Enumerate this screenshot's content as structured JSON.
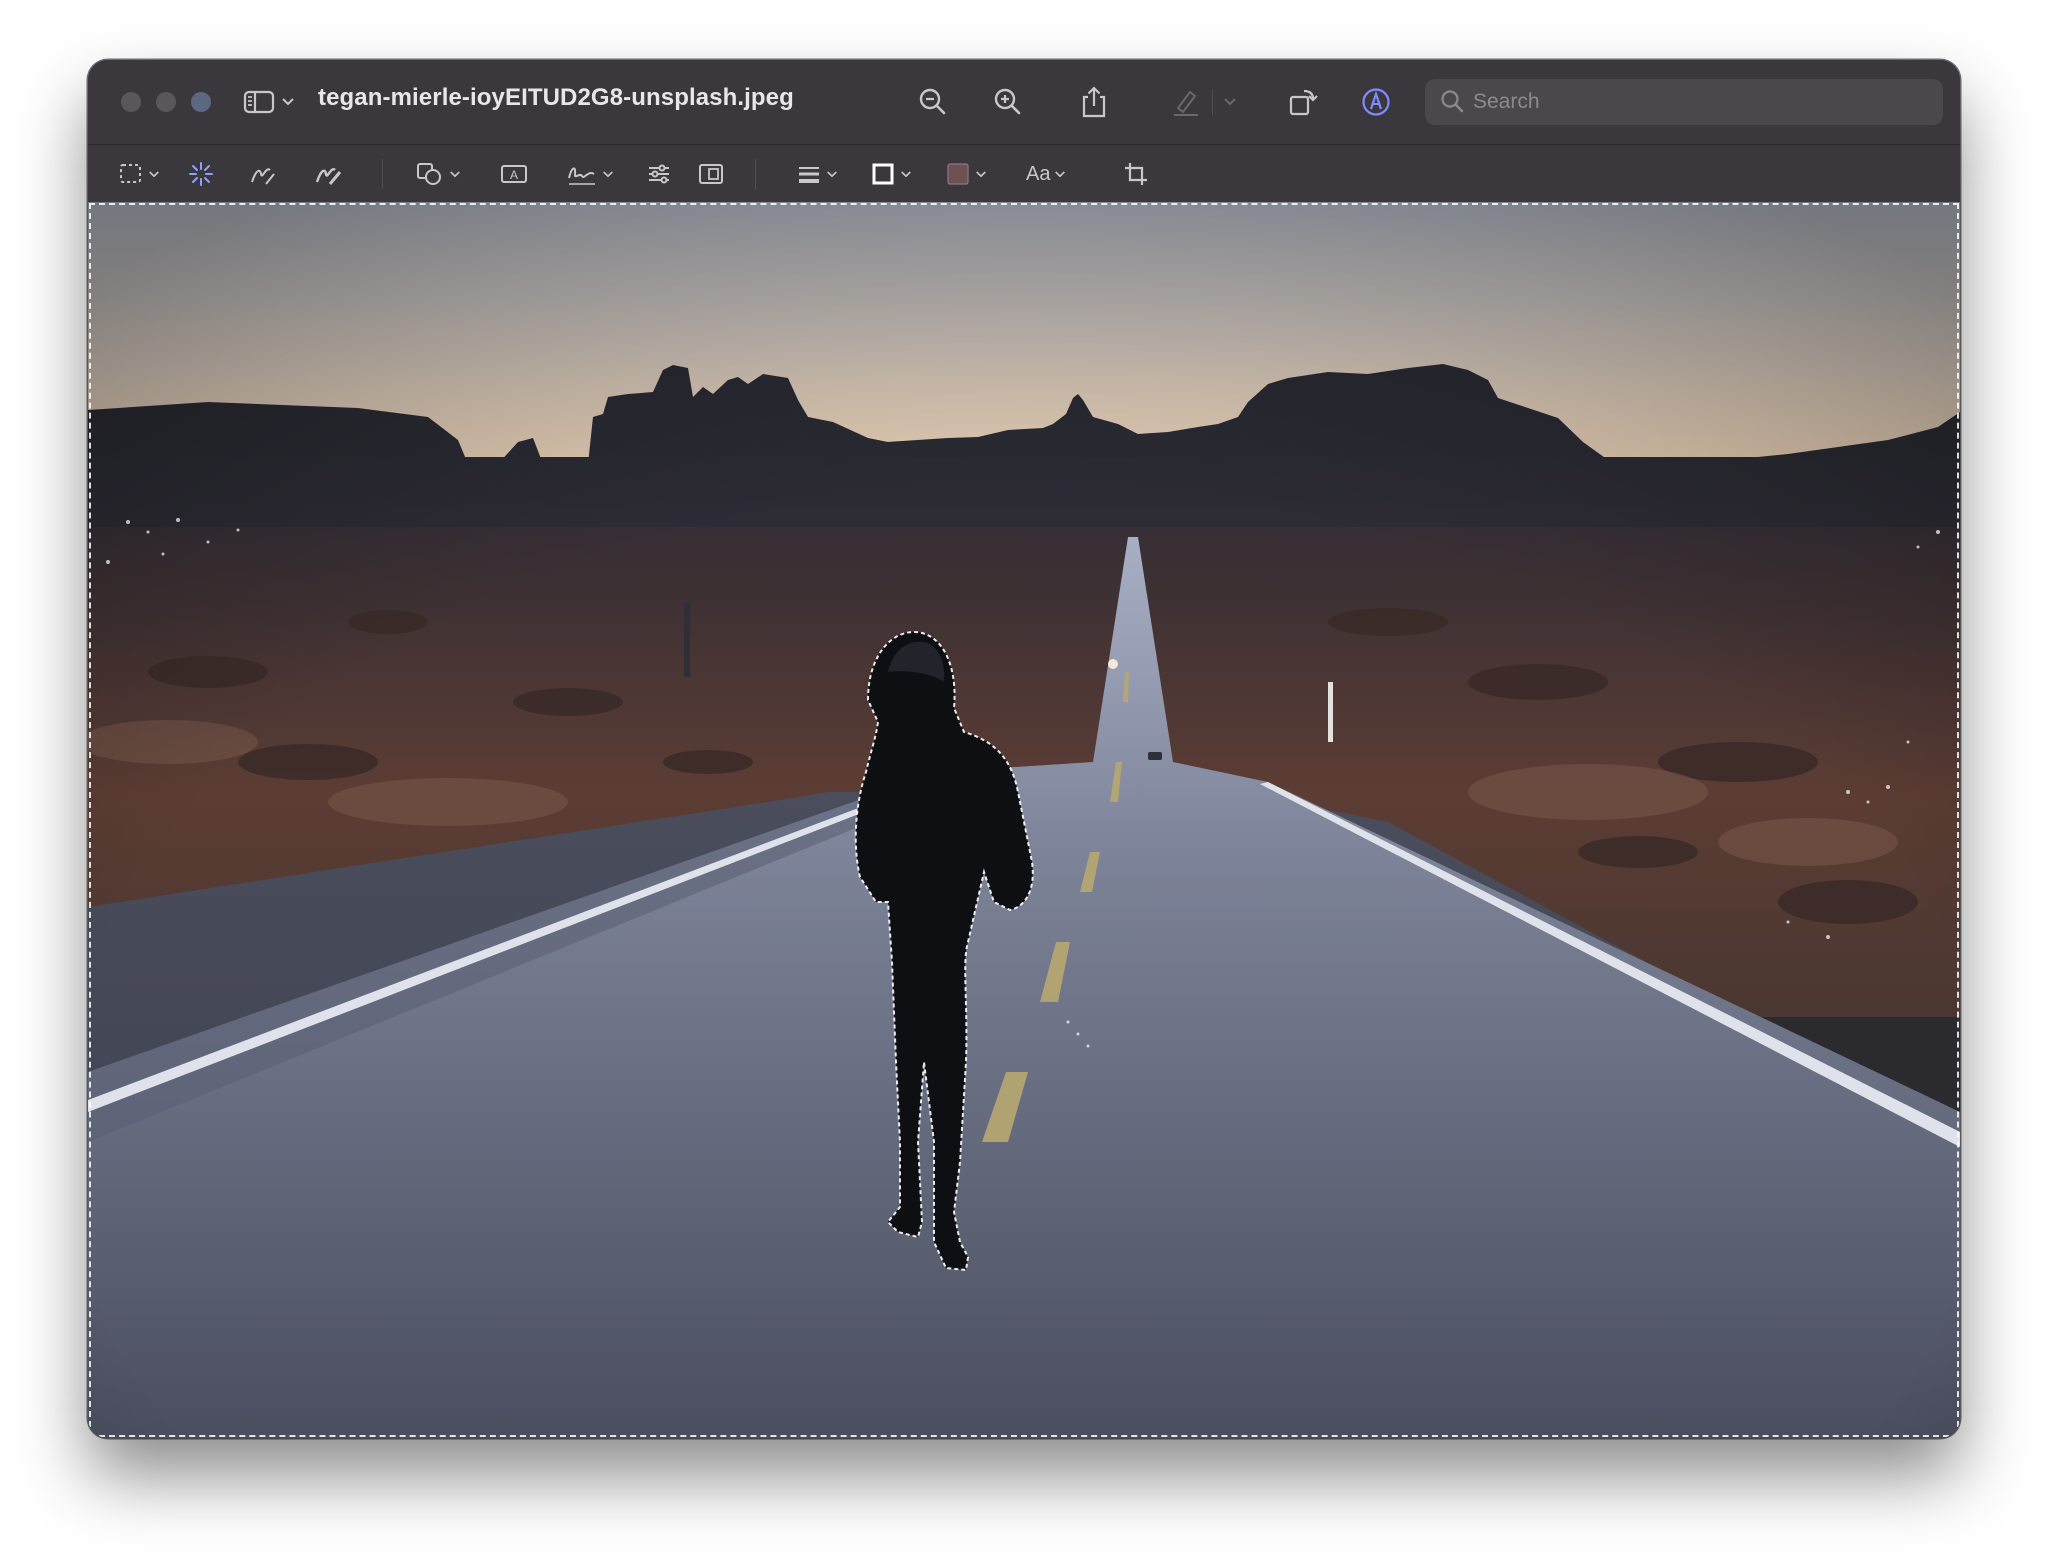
{
  "window": {
    "title": "tegan-mierle-ioyEITUD2G8-unsplash.jpeg"
  },
  "toolbar": {
    "search_placeholder": "Search",
    "text_style_label": "Aa"
  },
  "colors": {
    "titlebar": "#3a383c",
    "toolbar_icon": "#c9c7cc",
    "accent": "#7f8cff",
    "border_color_swatch": "#ffffff",
    "fill_color_swatch": "#6e4f52"
  },
  "icons": {
    "titlebar": [
      "sidebar-icon",
      "zoom-out-icon",
      "zoom-in-icon",
      "share-icon",
      "highlight-icon",
      "rotate-icon",
      "markup-icon",
      "search-icon"
    ],
    "markup": [
      "rect-select-icon",
      "instant-alpha-icon",
      "sketch-icon",
      "draw-icon",
      "shapes-icon",
      "text-box-icon",
      "sign-icon",
      "adjust-color-icon",
      "adjust-size-icon",
      "line-style-icon",
      "border-color-icon",
      "fill-color-icon",
      "text-style-icon",
      "crop-icon"
    ]
  }
}
